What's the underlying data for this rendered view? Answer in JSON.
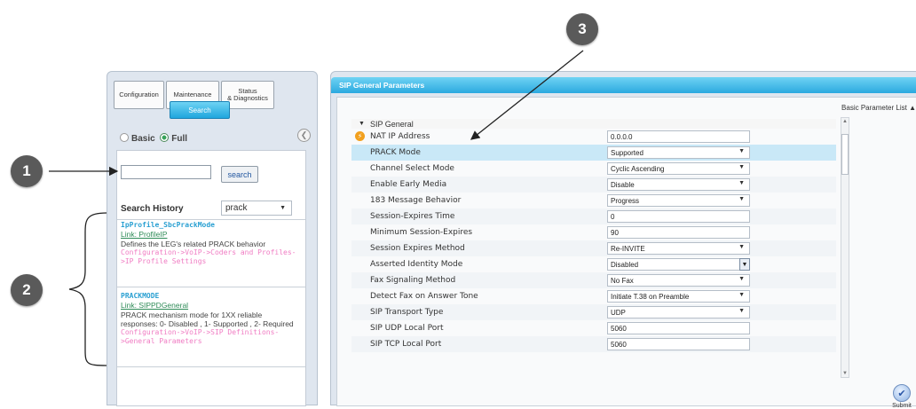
{
  "callouts": [
    "1",
    "2",
    "3"
  ],
  "left_panel": {
    "tabs": {
      "configuration": "Configuration",
      "maintenance": "Maintenance",
      "status_line1": "Status",
      "status_line2": "& Diagnostics",
      "search": "Search"
    },
    "mode_basic": "Basic",
    "mode_full": "Full",
    "search_input_value": "",
    "search_button": "search",
    "history_label": "Search History",
    "history_value": "prack",
    "results": [
      {
        "title": "IpProfile_SbcPrackMode",
        "link": "Link: ProfileIP",
        "description": "Defines the LEG's related PRACK behavior",
        "path": "Configuration->VoIP->Coders and Profiles->IP Profile Settings"
      },
      {
        "title": "PRACKMODE",
        "link": "Link: SIPPDGeneral",
        "description": "PRACK mechanism mode for 1XX reliable responses: 0- Disabled , 1- Supported , 2- Required",
        "path": "Configuration->VoIP->SIP Definitions->General Parameters"
      }
    ]
  },
  "right_panel": {
    "header": "SIP General Parameters",
    "basic_parameter_list": "Basic Parameter List",
    "section_title": "SIP General",
    "rows": [
      {
        "label": "NAT IP Address",
        "value": "0.0.0.0",
        "type": "text"
      },
      {
        "label": "PRACK Mode",
        "value": "Supported",
        "type": "select"
      },
      {
        "label": "Channel Select Mode",
        "value": "Cyclic Ascending",
        "type": "select"
      },
      {
        "label": "Enable Early Media",
        "value": "Disable",
        "type": "select"
      },
      {
        "label": "183 Message Behavior",
        "value": "Progress",
        "type": "select"
      },
      {
        "label": "Session-Expires Time",
        "value": "0",
        "type": "text"
      },
      {
        "label": "Minimum Session-Expires",
        "value": "90",
        "type": "text"
      },
      {
        "label": "Session Expires Method",
        "value": "Re-INVITE",
        "type": "select"
      },
      {
        "label": "Asserted Identity Mode",
        "value": "Disabled",
        "type": "select-open"
      },
      {
        "label": "Fax Signaling Method",
        "value": "No Fax",
        "type": "select"
      },
      {
        "label": "Detect Fax on Answer Tone",
        "value": "Initiate T.38 on Preamble",
        "type": "select"
      },
      {
        "label": "SIP Transport Type",
        "value": "UDP",
        "type": "select"
      },
      {
        "label": "SIP UDP Local Port",
        "value": "5060",
        "type": "text"
      },
      {
        "label": "SIP TCP Local Port",
        "value": "5060",
        "type": "text"
      }
    ],
    "submit_label": "Submit"
  },
  "colors": {
    "header_blue": "#2ba9df",
    "highlight_row": "#c9e8f7",
    "result_title": "#2aa0d2",
    "result_link": "#2e8b57",
    "result_path": "#f07cc3"
  }
}
